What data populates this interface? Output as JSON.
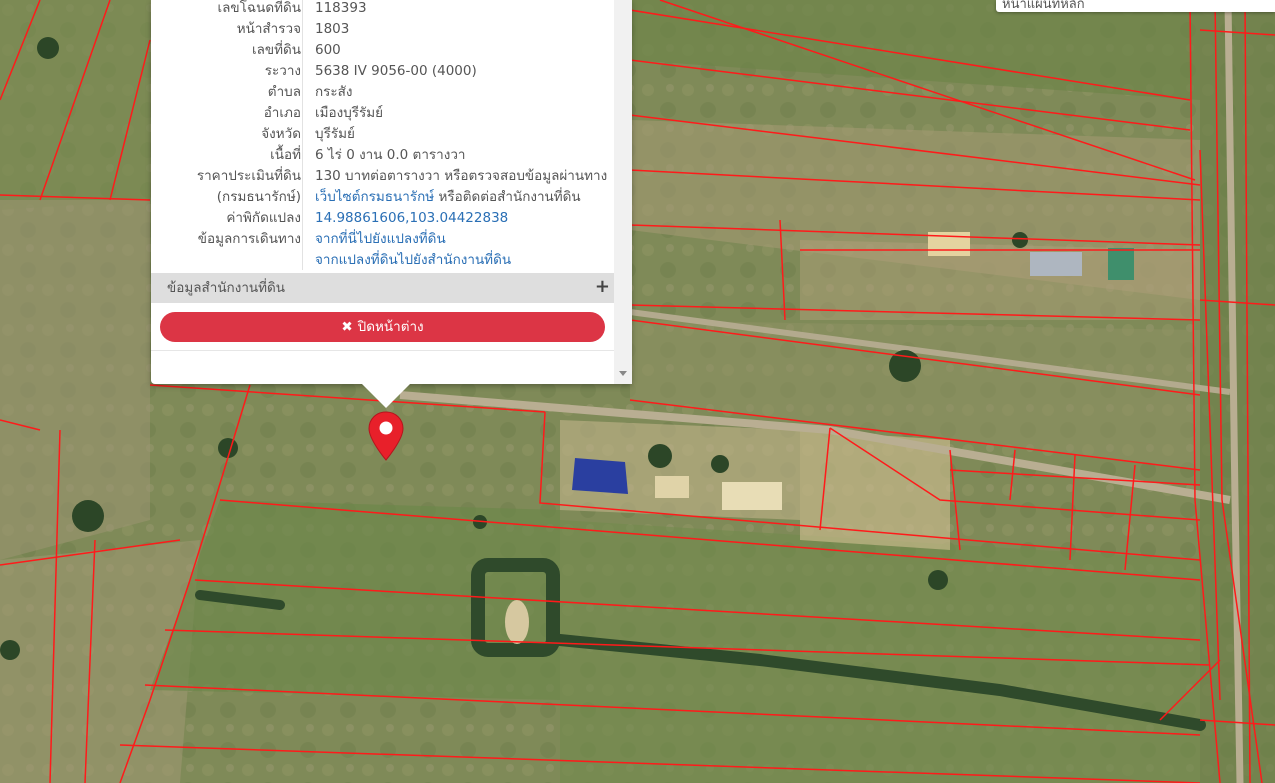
{
  "search": {
    "visible_text": "หน้าแผนที่หลัก"
  },
  "parcel_info": {
    "rows": [
      {
        "label": "เลขโฉนดที่ดิน",
        "value": "118393"
      },
      {
        "label": "หน้าสำรวจ",
        "value": "1803"
      },
      {
        "label": "เลขที่ดิน",
        "value": "600"
      },
      {
        "label": "ระวาง",
        "value": "5638 IV 9056-00 (4000)"
      },
      {
        "label": "ตำบล",
        "value": "กระสัง"
      },
      {
        "label": "อำเภอ",
        "value": "เมืองบุรีรัมย์"
      },
      {
        "label": "จังหวัด",
        "value": "บุรีรัมย์"
      },
      {
        "label": "เนื้อที่",
        "value": "6 ไร่ 0 งาน 0.0 ตารางวา"
      },
      {
        "label": "ราคาประเมินที่ดิน",
        "value": "130 บาทต่อตารางวา หรือตรวจสอบข้อมูลผ่านทาง"
      },
      {
        "label": "(กรมธนารักษ์)",
        "value_link": "เว็บไซต์กรมธนารักษ์",
        "value_suffix": " หรือติดต่อสำนักงานที่ดิน"
      },
      {
        "label": "ค่าพิกัดแปลง",
        "value": "14.98861606,103.04422838"
      },
      {
        "label": "ข้อมูลการเดินทาง",
        "value": "จากที่นี่ไปยังแปลงที่ดิน"
      },
      {
        "label": "",
        "value": "จากแปลงที่ดินไปยังสำนักงานที่ดิน"
      }
    ]
  },
  "office_section": {
    "label": "ข้อมูลสำนักงานที่ดิน",
    "expand_symbol": "+"
  },
  "close_button": {
    "label": "ปิดหน้าต่าง",
    "icon_glyph": "✖"
  },
  "marker": {
    "icon": "map-pin-icon",
    "color": "#e8202a"
  },
  "colors": {
    "parcel_lines": "#ff1a1a",
    "close_button": "#dc3545",
    "link": "#2a6fb5"
  }
}
